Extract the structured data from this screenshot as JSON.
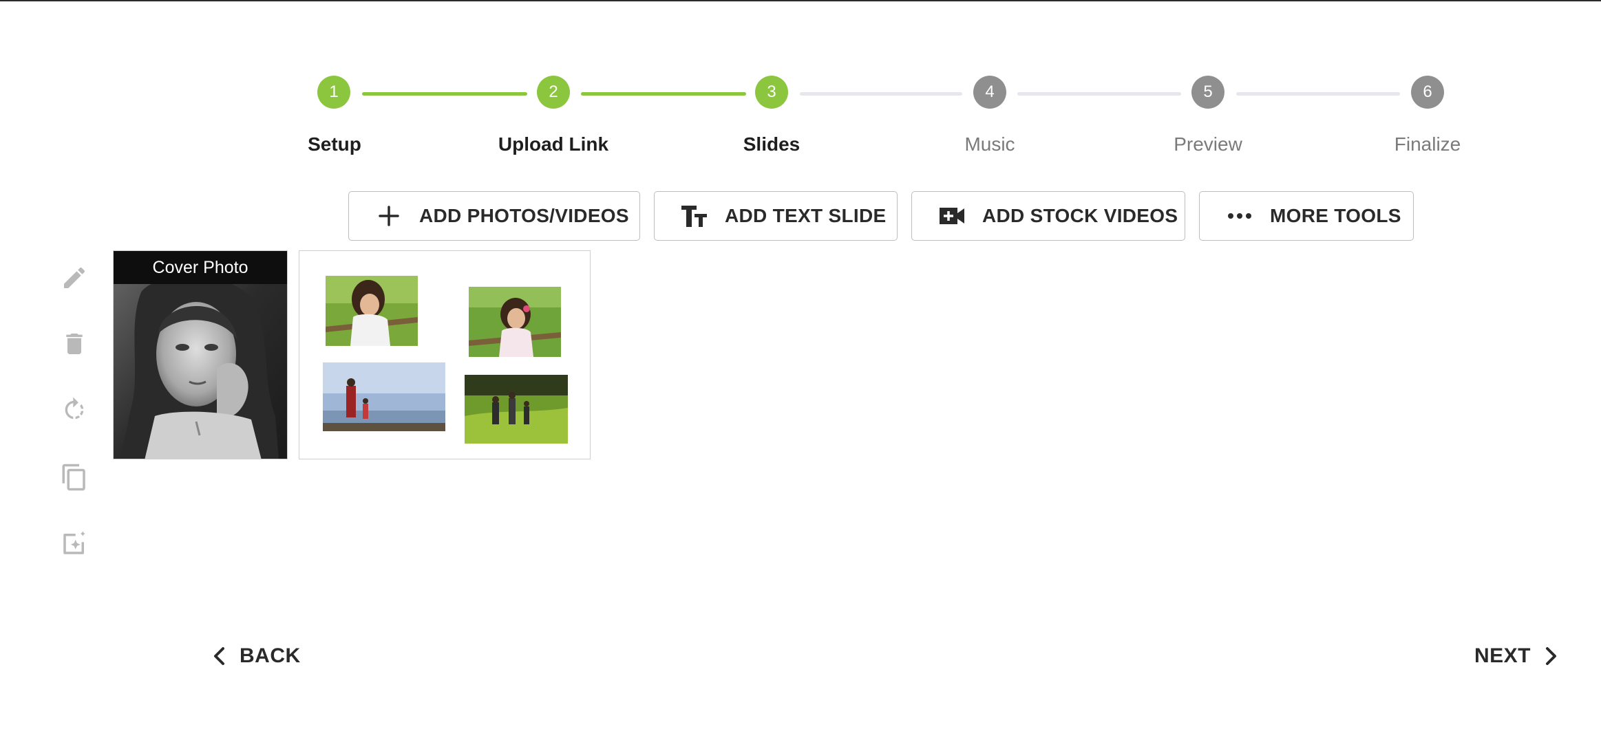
{
  "stepper": {
    "steps": [
      {
        "number": "1",
        "label": "Setup",
        "status": "complete"
      },
      {
        "number": "2",
        "label": "Upload Link",
        "status": "complete"
      },
      {
        "number": "3",
        "label": "Slides",
        "status": "current"
      },
      {
        "number": "4",
        "label": "Music",
        "status": "pending"
      },
      {
        "number": "5",
        "label": "Preview",
        "status": "pending"
      },
      {
        "number": "6",
        "label": "Finalize",
        "status": "pending"
      }
    ],
    "active_color": "#8cc63f",
    "inactive_color": "#8f8f8f"
  },
  "toolbar": {
    "add_photos": {
      "label": "ADD PHOTOS/VIDEOS",
      "icon": "plus-icon"
    },
    "add_text": {
      "label": "ADD TEXT SLIDE",
      "icon": "text-size-icon"
    },
    "add_stock": {
      "label": "ADD STOCK VIDEOS",
      "icon": "video-add-icon"
    },
    "more_tools": {
      "label": "MORE TOOLS",
      "icon": "more-horizontal-icon"
    }
  },
  "side_tools": [
    "pencil-icon",
    "trash-icon",
    "rotate-icon",
    "copy-icon",
    "auto-enhance-icon"
  ],
  "slides": [
    {
      "type": "cover",
      "caption": "Cover Photo"
    },
    {
      "type": "collage",
      "photos": 4
    }
  ],
  "navigation": {
    "back_label": "BACK",
    "next_label": "NEXT"
  }
}
